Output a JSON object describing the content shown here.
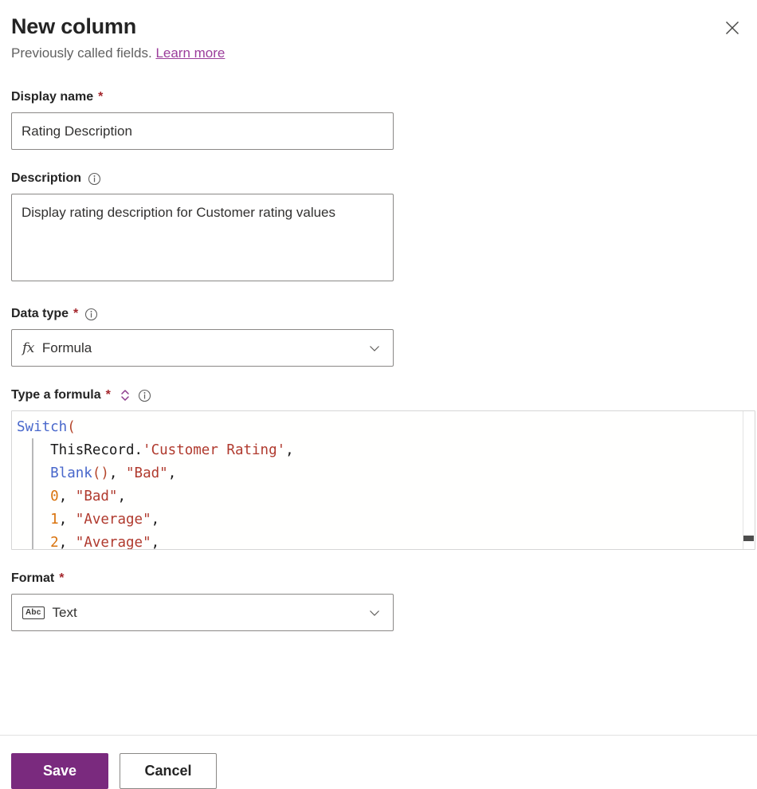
{
  "header": {
    "title": "New column",
    "subtitle_prefix": "Previously called fields.",
    "learn_more": "Learn more",
    "close_icon": "close-icon"
  },
  "fields": {
    "display_name": {
      "label": "Display name",
      "required_marker": "*",
      "value": "Rating Description",
      "placeholder": ""
    },
    "description": {
      "label": "Description",
      "info_icon": "info-icon",
      "value": "Display rating description for Customer rating values",
      "placeholder": ""
    },
    "data_type": {
      "label": "Data type",
      "required_marker": "*",
      "info_icon": "info-icon",
      "icon": "fx",
      "icon_name": "formula-fx-icon",
      "selected": "Formula",
      "chevron_icon": "chevron-down-icon"
    },
    "formula": {
      "label": "Type a formula",
      "required_marker": "*",
      "expand_icon": "expand-collapse-icon",
      "info_icon": "info-icon",
      "lines": [
        [
          {
            "t": "Switch",
            "c": "fn"
          },
          {
            "t": "(",
            "c": "punct"
          }
        ],
        [
          {
            "t": "    ThisRecord.",
            "c": "plain"
          },
          {
            "t": "'Customer Rating'",
            "c": "str"
          },
          {
            "t": ",",
            "c": "plain"
          }
        ],
        [
          {
            "t": "    ",
            "c": "plain"
          },
          {
            "t": "Blank",
            "c": "fn"
          },
          {
            "t": "()",
            "c": "punct"
          },
          {
            "t": ", ",
            "c": "plain"
          },
          {
            "t": "\"Bad\"",
            "c": "str"
          },
          {
            "t": ",",
            "c": "plain"
          }
        ],
        [
          {
            "t": "    ",
            "c": "plain"
          },
          {
            "t": "0",
            "c": "num"
          },
          {
            "t": ", ",
            "c": "plain"
          },
          {
            "t": "\"Bad\"",
            "c": "str"
          },
          {
            "t": ",",
            "c": "plain"
          }
        ],
        [
          {
            "t": "    ",
            "c": "plain"
          },
          {
            "t": "1",
            "c": "num"
          },
          {
            "t": ", ",
            "c": "plain"
          },
          {
            "t": "\"Average\"",
            "c": "str"
          },
          {
            "t": ",",
            "c": "plain"
          }
        ],
        [
          {
            "t": "    ",
            "c": "plain"
          },
          {
            "t": "2",
            "c": "num"
          },
          {
            "t": ", ",
            "c": "plain"
          },
          {
            "t": "\"Average\"",
            "c": "str"
          },
          {
            "t": ",",
            "c": "plain"
          }
        ]
      ],
      "plain_text": "Switch(\n    ThisRecord.'Customer Rating',\n    Blank(), \"Bad\",\n    0, \"Bad\",\n    1, \"Average\",\n    2, \"Average\","
    },
    "format": {
      "label": "Format",
      "required_marker": "*",
      "icon": "Abc",
      "icon_name": "text-abc-icon",
      "selected": "Text",
      "chevron_icon": "chevron-down-icon"
    }
  },
  "footer": {
    "save_label": "Save",
    "cancel_label": "Cancel"
  },
  "colors": {
    "accent_purple": "#7A2A7E",
    "link_purple": "#9B3D9B",
    "required_red": "#A4262C",
    "syntax_function": "#4867CB",
    "syntax_string": "#B03A2E",
    "syntax_number": "#D9730D",
    "syntax_punct": "#B5462B"
  }
}
